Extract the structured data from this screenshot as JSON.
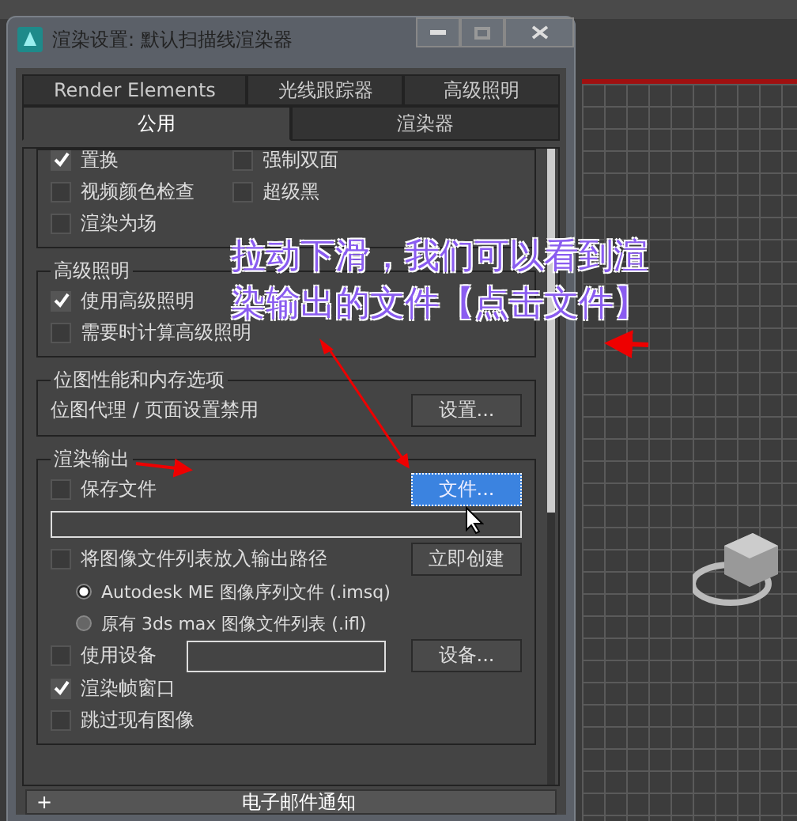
{
  "window": {
    "title": "渲染设置: 默认扫描线渲染器"
  },
  "tabs_row_1": [
    {
      "label": "Render Elements",
      "selected": false
    },
    {
      "label": "光线跟踪器",
      "selected": false
    },
    {
      "label": "高级照明",
      "selected": false
    }
  ],
  "tabs_row_2": [
    {
      "label": "公用",
      "selected": true
    },
    {
      "label": "渲染器",
      "selected": false
    }
  ],
  "options": [
    {
      "label": "置换",
      "checked": true
    },
    {
      "label": "强制双面",
      "checked": false
    },
    {
      "label": "视频颜色检查",
      "checked": false
    },
    {
      "label": "超级黑",
      "checked": false
    },
    {
      "label": "渲染为场",
      "checked": false
    }
  ],
  "advanced_lighting": {
    "title": "高级照明",
    "options": [
      {
        "label": "使用高级照明",
        "checked": true
      },
      {
        "label": "需要时计算高级照明",
        "checked": false
      }
    ]
  },
  "bitmap": {
    "title": "位图性能和内存选项",
    "text": "位图代理 / 页面设置禁用",
    "button": "设置..."
  },
  "render_output": {
    "title": "渲染输出",
    "save_file": {
      "label": "保存文件",
      "checked": false
    },
    "file_button": "文件...",
    "put_list": {
      "label": "将图像文件列表放入输出路径",
      "checked": false
    },
    "create_button": "立即创建",
    "formats": [
      {
        "label": "Autodesk ME 图像序列文件 (.imsq)",
        "selected": true
      },
      {
        "label": "原有 3ds max 图像文件列表 (.ifl)",
        "selected": false
      }
    ],
    "use_device": {
      "label": "使用设备",
      "checked": false
    },
    "device_button": "设备...",
    "extra": [
      {
        "label": "渲染帧窗口",
        "checked": true
      },
      {
        "label": "跳过现有图像",
        "checked": false
      }
    ]
  },
  "rollout": {
    "symbol": "+",
    "title": "电子邮件通知"
  },
  "annotation": [
    "拉动下滑，我们可以看到渲",
    "染输出的文件【点击文件】"
  ]
}
